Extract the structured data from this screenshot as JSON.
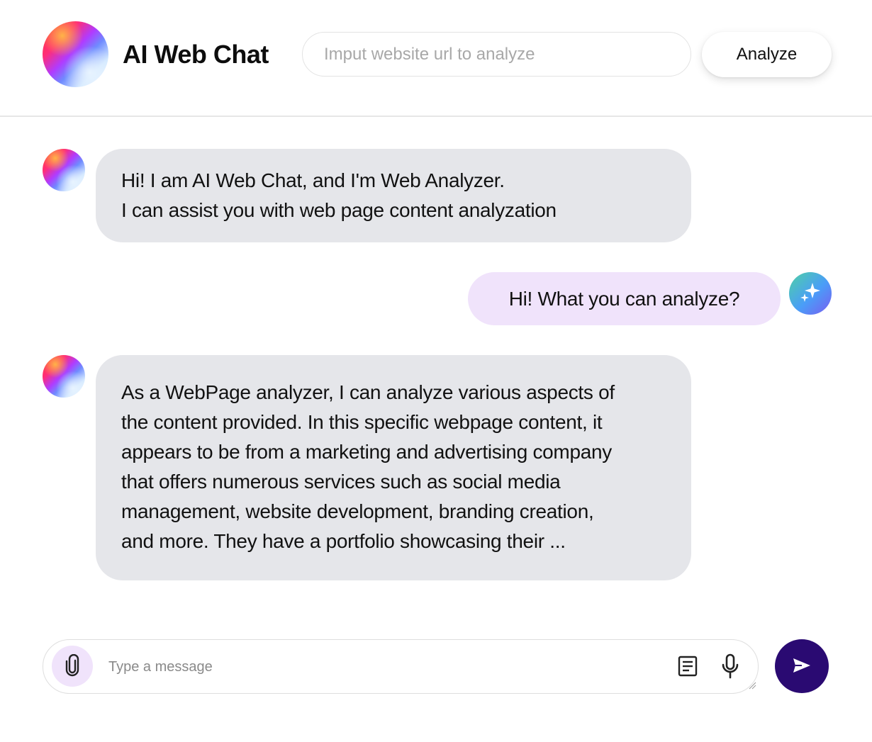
{
  "header": {
    "title": "AI Web Chat",
    "url_placeholder": "Imput website url to analyze",
    "url_value": "",
    "analyze_label": "Analyze"
  },
  "messages": [
    {
      "role": "bot",
      "lines": [
        "Hi! I am AI Web Chat, and I'm Web Analyzer.",
        "I can assist you with web page content analyzation"
      ]
    },
    {
      "role": "user",
      "lines": [
        "Hi! What you can analyze?"
      ]
    },
    {
      "role": "bot",
      "lines": [
        "As a WebPage analyzer, I can analyze various aspects of",
        "the content provided. In this specific webpage content, it",
        "appears to be from a marketing and advertising company",
        "that offers numerous services such as social media",
        "management, website development, branding creation,",
        "and more. They have a portfolio showcasing their ..."
      ]
    }
  ],
  "composer": {
    "placeholder": "Type a message",
    "value": ""
  },
  "icons": {
    "logo": "gradient-orb-logo",
    "bot_avatar": "gradient-orb-avatar",
    "user_avatar": "sparkles-icon",
    "attach": "paperclip-icon",
    "document": "document-icon",
    "microphone": "microphone-icon",
    "send": "send-icon"
  },
  "colors": {
    "bot_bubble": "#e5e6ea",
    "user_bubble": "#f0e3fb",
    "attach_bg": "#f0e3fb",
    "send_bg": "#2a0a72"
  }
}
